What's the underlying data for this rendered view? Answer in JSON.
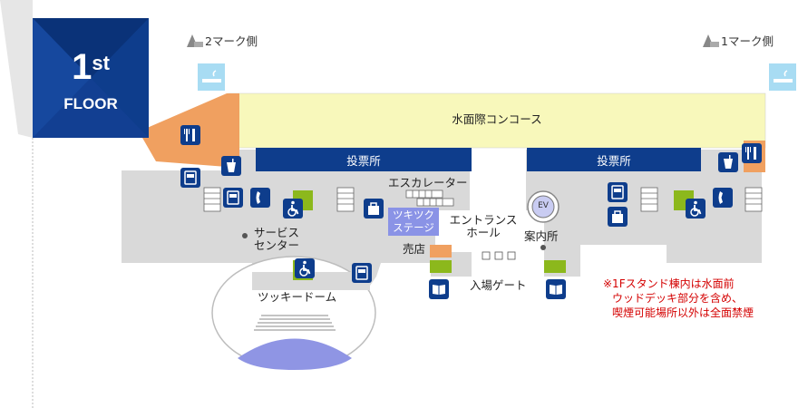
{
  "floor": {
    "number": "1",
    "suffix": "st",
    "word": "FLOOR"
  },
  "marks": {
    "left": "2マーク側",
    "right": "1マーク側"
  },
  "areas": {
    "concourse": "水面際コンコース",
    "ticket_left": "投票所",
    "ticket_right": "投票所",
    "escalator": "エスカレーター",
    "entrance_hall": [
      "エントランス",
      "ホール"
    ],
    "service_center": [
      "サービス",
      "センター"
    ],
    "tsukky_dome": "ツッキードーム",
    "tsukky_stage": [
      "ツキツク",
      "ステージ"
    ],
    "shop": "売店",
    "info": "案内所",
    "gate": "入場ゲート",
    "ev": "EV"
  },
  "note": [
    "※1Fスタンド棟内は水面前",
    "ウッドデッキ部分を含め、",
    "喫煙可能場所以外は全面禁煙"
  ],
  "colors": {
    "navy": "#0e3d8c",
    "concourse": "#f8f8bb",
    "floor_gray": "#d9d9d9",
    "orange": "#f0a060",
    "green": "#8cb81c",
    "smoking": "#a8dcf3",
    "stage": "#8a93e6",
    "dome": "#8f95e4",
    "note": "#d40000"
  },
  "icons": [
    "restaurant-icon",
    "drink-icon",
    "atm-icon",
    "phone-icon",
    "wheelchair-icon",
    "locker-icon",
    "newspaper-icon",
    "smoking-area-icon",
    "elevator-icon"
  ]
}
